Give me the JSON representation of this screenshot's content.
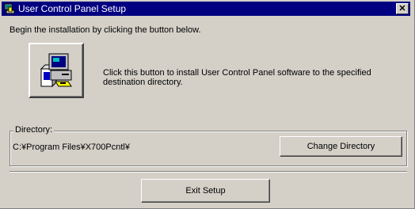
{
  "window": {
    "title": "User Control Panel Setup",
    "close_glyph": "✕"
  },
  "intro_text": "Begin the installation by clicking the button below.",
  "install": {
    "icon": "computer-install-icon",
    "description": "Click this button to install User Control Panel software to the specified destination directory."
  },
  "directory": {
    "label": "Directory:",
    "path": "C:¥Program Files¥X700Pcntl¥",
    "change_button": "Change Directory"
  },
  "exit_button": "Exit Setup",
  "colors": {
    "titlebar": "#000080",
    "face": "#d4d0c8"
  }
}
